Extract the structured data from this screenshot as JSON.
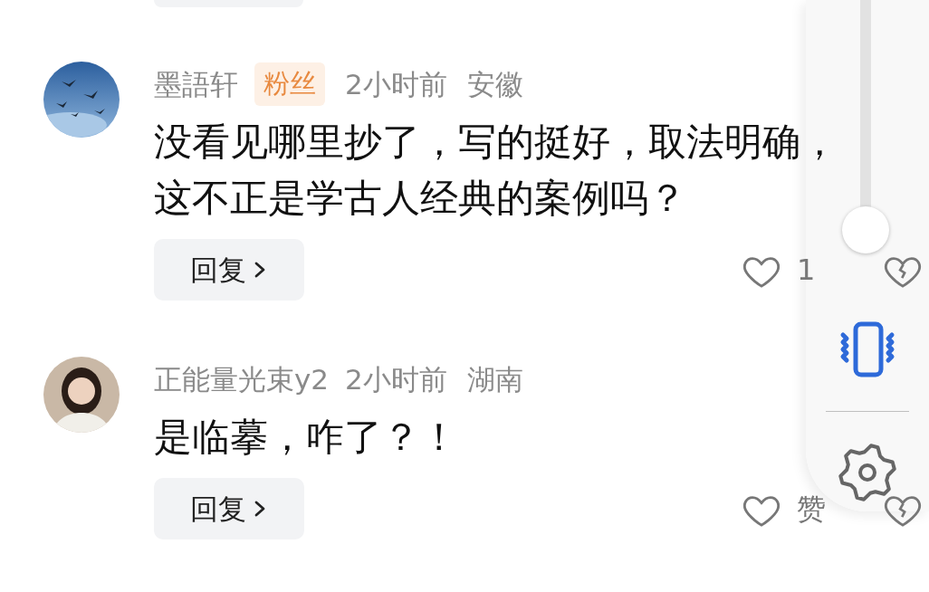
{
  "comments": [
    {
      "username": "墨語轩",
      "badge": "粉丝",
      "time": "2小时前",
      "location": "安徽",
      "text": "没看见哪里抄了，写的挺好，取法明确，这不正是学古人经典的案例吗？",
      "reply_label": "回复",
      "like_label": "1",
      "liked": false,
      "disliked": false
    },
    {
      "avatar": {
        "kind": "figure"
      },
      "username": "正能量光束y2",
      "time": "2小时前",
      "location": "湖南",
      "text": "是临摹，咋了？！",
      "reply_label": "回复",
      "like_label": "赞",
      "liked": false,
      "disliked": false
    }
  ],
  "side_panel": {
    "slider": {
      "level": 0.05
    },
    "vibrate_active": true
  }
}
